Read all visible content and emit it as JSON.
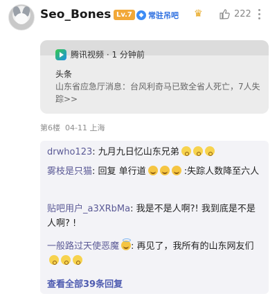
{
  "header": {
    "username": "Seo_Bones",
    "level": "Lv.7",
    "resident_badge": "常驻吊吧",
    "like_count": "222"
  },
  "link_card": {
    "source": "腾讯视频 · 1 分钟前",
    "kicker": "头条",
    "text": "山东省应急厅消息：台风利奇马已致全省人死亡，7人失踪>>"
  },
  "meta": {
    "floor": "第6楼",
    "date": "04-11",
    "location": "上海"
  },
  "replies": [
    {
      "name": "drwho123",
      "sep": ": ",
      "text": "九月九日忆山东兄弟",
      "emoji": [
        "wow",
        "wow",
        "wow"
      ]
    },
    {
      "name": "雾枝是只猫",
      "sep": ": ",
      "text_before": "回复 单行道",
      "emoji": [
        "grin",
        "grin",
        "grin"
      ],
      "text_after": " :失踪人数降至六人"
    },
    {
      "name": "贴吧用户_a3XRbMa",
      "sep": ": ",
      "text": "我是不是人啊?! 我到底是不是人啊? !"
    },
    {
      "name": "一般路过天使恶魔",
      "name_emoji": "halo",
      "sep": ": ",
      "text": "再见了，我所有的山东网友们",
      "emoji": [
        "wow",
        "wow",
        "wow"
      ]
    }
  ],
  "view_all": "查看全部39条回复"
}
